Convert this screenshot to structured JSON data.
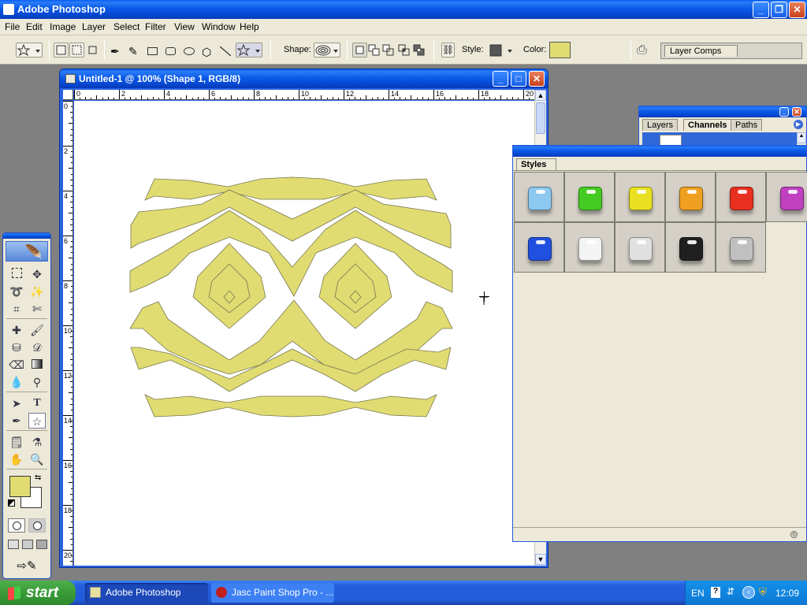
{
  "app": {
    "title": "Adobe Photoshop"
  },
  "menu": [
    "File",
    "Edit",
    "Image",
    "Layer",
    "Select",
    "Filter",
    "View",
    "Window",
    "Help"
  ],
  "options": {
    "shape_label": "Shape:",
    "style_label": "Style:",
    "color_label": "Color:",
    "layer_comps": "Layer Comps",
    "fill_color": "#e0dc72"
  },
  "document": {
    "title": "Untitled-1 @ 100% (Shape 1, RGB/8)",
    "ruler_h": [
      "0",
      "2",
      "4",
      "6",
      "8",
      "10",
      "12",
      "14",
      "16",
      "18",
      "20"
    ],
    "ruler_v": [
      "0",
      "2",
      "4",
      "6",
      "8",
      "10",
      "12",
      "14",
      "16",
      "18",
      "20"
    ]
  },
  "layers_panel": {
    "tabs": [
      "Layers",
      "Channels",
      "Paths"
    ],
    "active": "Channels"
  },
  "styles_panel": {
    "tab": "Styles",
    "swatches": [
      {
        "name": "light-blue",
        "color": "#8cc8f0"
      },
      {
        "name": "green",
        "color": "#44cc22"
      },
      {
        "name": "yellow",
        "color": "#e8e020"
      },
      {
        "name": "orange",
        "color": "#f0a020"
      },
      {
        "name": "red",
        "color": "#e83020"
      },
      {
        "name": "purple",
        "color": "#c040c0"
      },
      {
        "name": "blue",
        "color": "#2050e0"
      },
      {
        "name": "white",
        "color": "#f4f4f4"
      },
      {
        "name": "silver",
        "color": "#e0e0e0"
      },
      {
        "name": "black",
        "color": "#202020"
      },
      {
        "name": "gray",
        "color": "#c0c0c0"
      }
    ]
  },
  "taskbar": {
    "start": "start",
    "tasks": [
      "Adobe Photoshop",
      "Jasc Paint Shop Pro - ..."
    ],
    "lang": "EN",
    "clock": "12:09"
  }
}
